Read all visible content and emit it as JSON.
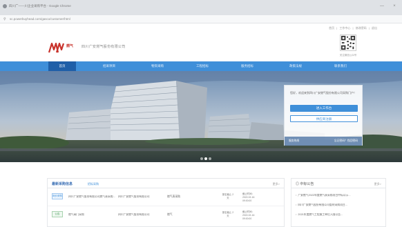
{
  "window": {
    "title": "四川广——川企业采购平台 - Google Chrome",
    "url": "sc.powerbuyhead.com/gasco/customer/html",
    "minimize": "—",
    "close": "×"
  },
  "toplinks": [
    "首页",
    "|",
    "工作中心",
    "|",
    "修改密码",
    "|",
    "退出"
  ],
  "logo": {
    "short": "燃气",
    "name": "四川广安燃气股份有限公司"
  },
  "qr_caption": "关注微信公众号",
  "nav": [
    "首页",
    "招采项目",
    "物资采购",
    "工程招标",
    "服务招标",
    "政策法规",
    "联系我们"
  ],
  "login": {
    "greeting": "您好，欢迎来到四川广安燃气股份有限公司采购门户！",
    "login_button": "进入工作台",
    "register_button": "供应商注册",
    "footer_left": "服务热线",
    "footer_right": "忘记密码？找回密码"
  },
  "procurement": {
    "title": "最新采购信息",
    "tab": "招标采购",
    "more": "更多>",
    "rows": [
      {
        "badge": "询价采购",
        "title": "四川广安燃气股份有限公司燃气表采购...",
        "org": "四川广安燃气股份有限公司",
        "type": "燃气表采购",
        "status": "报名截止 2天",
        "date_label": "截止时间：",
        "date": "2022-02-16 09:00:00",
        "color": "blue"
      },
      {
        "badge": "公告",
        "title": "燃气阀门采购",
        "org": "四川广安燃气股份有限公司",
        "type": "燃气",
        "status": "报名截止 2天",
        "date_label": "截止时间：",
        "date": "2022-02-16 09:00:00",
        "color": "green"
      }
    ]
  },
  "news": {
    "title": "中标公告",
    "more": "更多>",
    "items": [
      "广安燃气2022年度燃气表采购项目中标公示...",
      "四川广安燃气股份有限公司管材采购项目...",
      "2021年度燃气工程施工单位入围公告..."
    ]
  },
  "colors": {
    "nav_bg": "#3f8fd9",
    "nav_active": "#1f5fa8",
    "brand_red": "#c8322b"
  },
  "slider": {
    "count": 3,
    "active": 1
  }
}
